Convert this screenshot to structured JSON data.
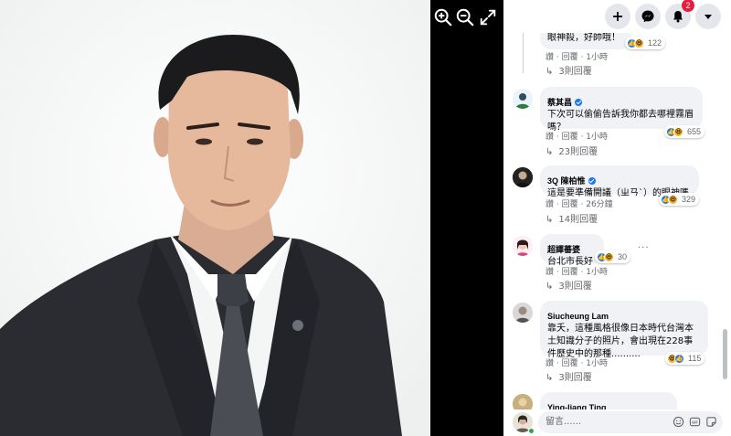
{
  "viewer": {
    "zoom_in_icon": "zoom-in-icon",
    "zoom_out_icon": "zoom-out-icon",
    "fullscreen_icon": "expand-icon"
  },
  "topbar": {
    "create_icon": "plus-icon",
    "messenger_icon": "messenger-icon",
    "notifications_icon": "bell-icon",
    "notifications_count": "2",
    "account_icon": "caret-down-icon"
  },
  "comments": [
    {
      "author": "",
      "verified": false,
      "text": "眼神殺，好帥哦！",
      "reactions": {
        "types": [
          "like",
          "haha"
        ],
        "count": "122"
      },
      "actions": {
        "like": "讚",
        "reply": "回覆",
        "time": "1小時"
      },
      "replies": "3則回覆"
    },
    {
      "author": "蔡其昌",
      "verified": true,
      "text": "下次可以偷偷告訴我你都去哪裡霧眉嗎？",
      "reactions": {
        "types": [
          "like",
          "haha"
        ],
        "count": "655"
      },
      "actions": {
        "like": "讚",
        "reply": "回覆",
        "time": "1小時"
      },
      "replies": "23則回覆"
    },
    {
      "author": "3Q 陳柏惟",
      "verified": true,
      "text": "這是要準備開議（ㄓㄢˋ）的眼神嗎",
      "reactions": {
        "types": [
          "like",
          "haha"
        ],
        "count": "329"
      },
      "actions": {
        "like": "讚",
        "reply": "回覆",
        "time": "26分鐘"
      },
      "replies": "14則回覆"
    },
    {
      "author": "超譯蕃婆",
      "verified": false,
      "text": "台北市長好",
      "reactions": {
        "types": [
          "like",
          "haha"
        ],
        "count": "30"
      },
      "actions": {
        "like": "讚",
        "reply": "回覆",
        "time": "1小時"
      },
      "replies": "3則回覆"
    },
    {
      "author": "Siucheung Lam",
      "verified": false,
      "text": "靠夭，這種風格很像日本時代台灣本土知識分子的照片，會出現在228事件歷史中的那種..........",
      "reactions": {
        "types": [
          "haha",
          "like"
        ],
        "count": "115"
      },
      "actions": {
        "like": "讚",
        "reply": "回覆",
        "time": "1小時"
      },
      "replies": "3則回覆"
    },
    {
      "author": "Ying-liang Ting",
      "verified": false,
      "text": ""
    }
  ],
  "composer": {
    "placeholder": "留言......",
    "icons": [
      "smile-icon",
      "gif-icon",
      "sticker-icon"
    ]
  },
  "colors": {
    "accent": "#1877f2",
    "badge": "#e41e3f",
    "bubble": "#f0f2f5",
    "muted_text": "#65676b"
  }
}
